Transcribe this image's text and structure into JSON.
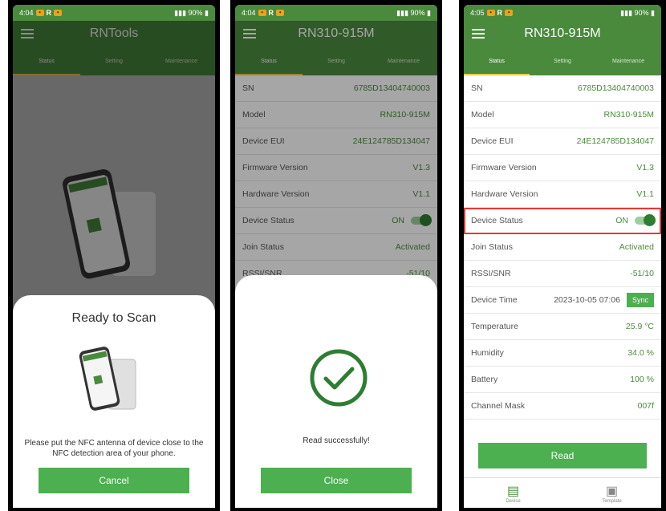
{
  "colors": {
    "primary": "#4a8a3c",
    "button": "#4caf50",
    "highlight": "#e53935"
  },
  "status_bar": {
    "time_1": "4:04",
    "time_2": "4:04",
    "time_3": "4:05",
    "battery": "90%"
  },
  "screen1": {
    "title": "RNTools",
    "tabs": [
      "Status",
      "Setting",
      "Maintenance"
    ],
    "sheet_title": "Ready to Scan",
    "sheet_text": "Please put the NFC antenna of device close to the NFC detection area of your phone.",
    "button": "Cancel"
  },
  "screen2": {
    "title": "RN310-915M",
    "tabs": [
      "Status",
      "Setting",
      "Maintenance"
    ],
    "rows": [
      {
        "k": "SN",
        "v": "6785D13404740003"
      },
      {
        "k": "Model",
        "v": "RN310-915M"
      },
      {
        "k": "Device EUI",
        "v": "24E124785D134047"
      },
      {
        "k": "Firmware Version",
        "v": "V1.3"
      },
      {
        "k": "Hardware Version",
        "v": "V1.1"
      },
      {
        "k": "Device Status",
        "v": "ON"
      },
      {
        "k": "Join Status",
        "v": "Activated"
      },
      {
        "k": "RSSI/SNR",
        "v": "-51/10"
      }
    ],
    "message": "Read successfully!",
    "button": "Close"
  },
  "screen3": {
    "title": "RN310-915M",
    "tabs": [
      "Status",
      "Setting",
      "Maintenance"
    ],
    "rows": [
      {
        "k": "SN",
        "v": "6785D13404740003"
      },
      {
        "k": "Model",
        "v": "RN310-915M"
      },
      {
        "k": "Device EUI",
        "v": "24E124785D134047"
      },
      {
        "k": "Firmware Version",
        "v": "V1.3"
      },
      {
        "k": "Hardware Version",
        "v": "V1.1"
      },
      {
        "k": "Device Status",
        "v": "ON"
      },
      {
        "k": "Join Status",
        "v": "Activated"
      },
      {
        "k": "RSSI/SNR",
        "v": "-51/10"
      },
      {
        "k": "Device Time",
        "v": "2023-10-05 07:06"
      },
      {
        "k": "Temperature",
        "v": "25.9 °C"
      },
      {
        "k": "Humidity",
        "v": "34.0 %"
      },
      {
        "k": "Battery",
        "v": "100 %"
      },
      {
        "k": "Channel Mask",
        "v": "007f"
      }
    ],
    "sync_label": "Sync",
    "read_button": "Read",
    "nav": [
      "Device",
      "Template"
    ]
  }
}
